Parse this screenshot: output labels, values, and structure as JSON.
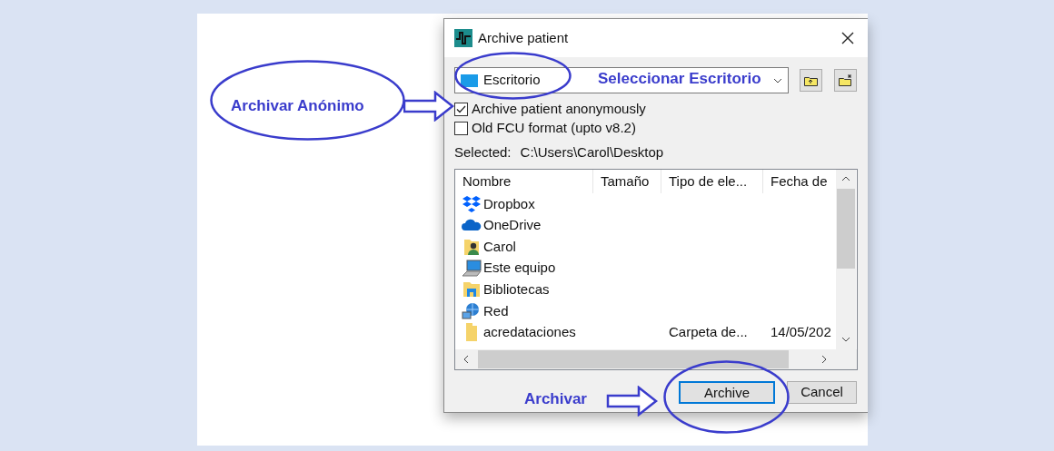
{
  "window": {
    "title": "Archive patient"
  },
  "location": {
    "value": "Escritorio"
  },
  "options": [
    {
      "label": "Archive patient anonymously",
      "checked": true
    },
    {
      "label": "Old FCU format (upto v8.2)",
      "checked": false
    }
  ],
  "selected_path": {
    "label": "Selected:",
    "value": "C:\\Users\\Carol\\Desktop"
  },
  "file_list": {
    "columns": [
      "Nombre",
      "Tamaño",
      "Tipo de ele...",
      "Fecha de"
    ],
    "rows": [
      {
        "kind": "dropbox",
        "name": "Dropbox"
      },
      {
        "kind": "onedrive",
        "name": "OneDrive"
      },
      {
        "kind": "user",
        "name": "Carol"
      },
      {
        "kind": "computer",
        "name": "Este equipo"
      },
      {
        "kind": "library",
        "name": "Bibliotecas"
      },
      {
        "kind": "network",
        "name": "Red"
      },
      {
        "kind": "folder",
        "name": "acredataciones",
        "type": "Carpeta de...",
        "date": "14/05/202"
      }
    ]
  },
  "buttons": [
    {
      "label": "Archive",
      "default": true
    },
    {
      "label": "Cancel",
      "default": false
    }
  ],
  "annotations": [
    {
      "kind": "anonymous",
      "text": "Archivar Anónimo"
    },
    {
      "kind": "location",
      "text": "Seleccionar Escritorio"
    },
    {
      "kind": "archive",
      "text": "Archivar"
    }
  ]
}
